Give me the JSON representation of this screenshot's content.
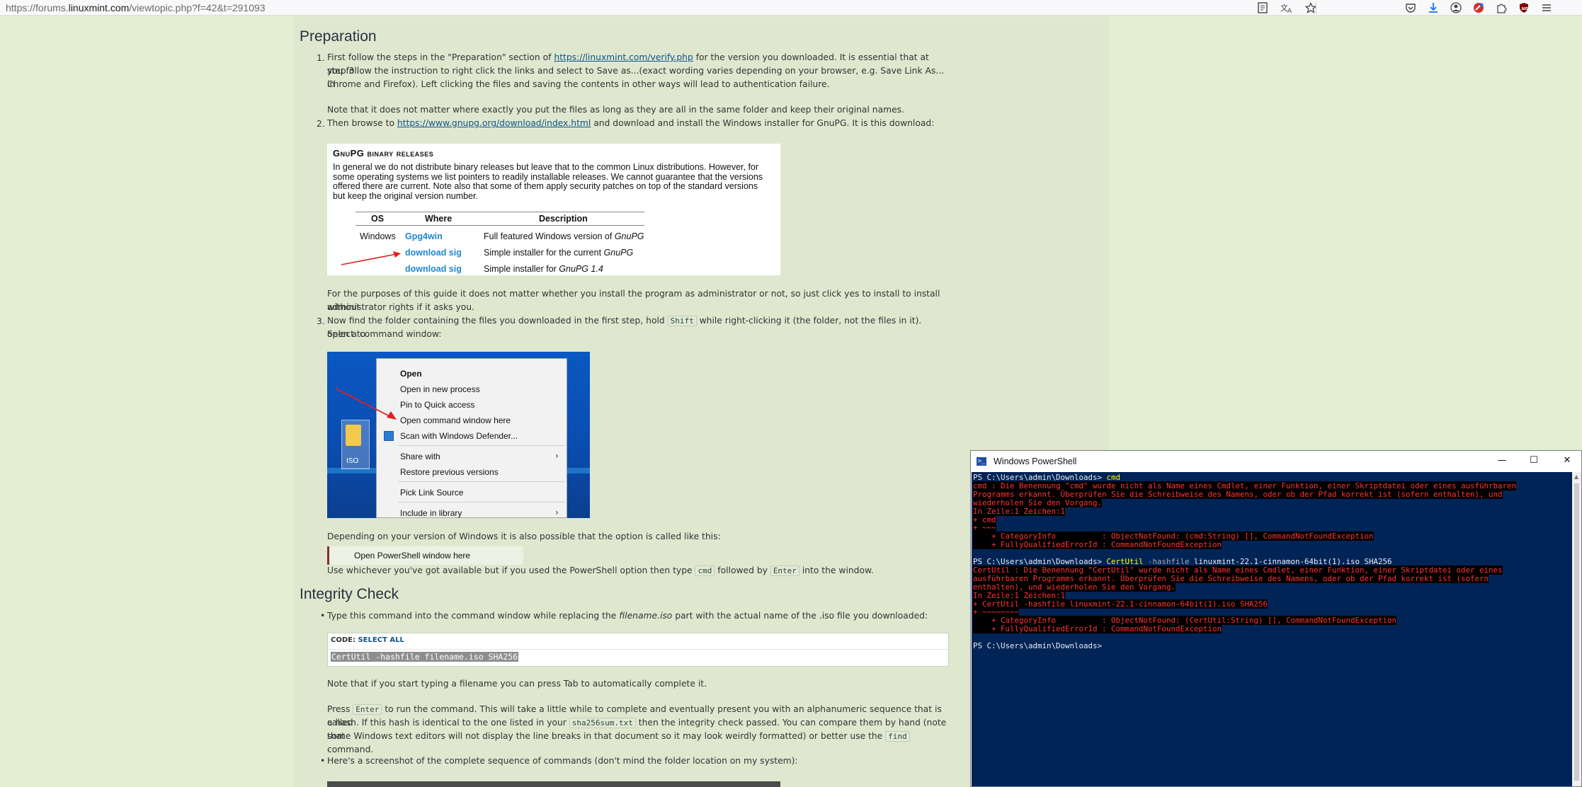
{
  "browser": {
    "url_prefix": "https://forums.",
    "url_domain": "linuxmint.com",
    "url_path": "/viewtopic.php?f=42&t=291093",
    "icons_left": [
      "reader-view-icon",
      "translate-icon",
      "bookmark-star-icon"
    ],
    "icons_right": [
      "pocket-icon",
      "downloads-icon",
      "account-icon",
      "extension-red-icon",
      "extensions-icon",
      "ublock-icon",
      "menu-icon"
    ]
  },
  "section_preparation": {
    "heading": "Preparation",
    "step1_num": "1.",
    "step1_a": "First follow the steps in the \"Preparation\" section of ",
    "step1_link": "https://linuxmint.com/verify.php",
    "step1_b": " for the version you downloaded. It is essential that at step 3",
    "step1_line2": "you follow the instruction to right click the links and select to Save as...(exact wording varies depending on your browser, e.g. Save Link As... in",
    "step1_line3": "Chrome and Firefox). Left clicking the files and saving the contents in other ways will lead to authentication failure.",
    "step1_note": "Note that it does not matter where exactly you put the files as long as they are all in the same folder and keep their original names.",
    "step2_num": "2.",
    "step2_a": "Then browse to ",
    "step2_link": "https://www.gnupg.org/download/index.html",
    "step2_b": " and download and install the Windows installer for GnuPG. It is this download:",
    "gnupg": {
      "title": "GnuPG binary releases",
      "desc": "In general we do not distribute binary releases but leave that to the common Linux distributions. However, for some operating systems we list pointers to readily installable releases. We cannot guarantee that the versions offered there are current. Note also that some of them apply security patches on top of the standard versions but keep the original version number.",
      "headers": [
        "OS",
        "Where",
        "Description"
      ],
      "rows": [
        {
          "os": "Windows",
          "where": "Gpg4win",
          "desc_a": "Full featured Windows version of ",
          "desc_b": "GnuPG"
        },
        {
          "os": "",
          "where": "download sig",
          "desc_a": "Simple installer for the current ",
          "desc_b": "GnuPG"
        },
        {
          "os": "",
          "where": "download sig",
          "desc_a": "Simple installer for ",
          "desc_b": "GnuPG 1.4"
        }
      ]
    },
    "step2_note_l1": "For the purposes of this guide it does not matter whether you install the program as administrator or not, so just click yes to install to install without",
    "step2_note_l2": "administrator rights if it asks you.",
    "step3_num": "3.",
    "step3_a": "Now find the folder containing the files you downloaded in the first step, hold ",
    "step3_kbd": "Shift",
    "step3_b": " while right-clicking it (the folder, not the files in it). Select to",
    "step3_line2": "open a command window:",
    "ctx_menu": {
      "folder_label": "ISO",
      "items": [
        "Open",
        "Open in new process",
        "Pin to Quick access",
        "Open command window here",
        "Scan with Windows Defender...",
        "Share with",
        "Restore previous versions",
        "Pick Link Source",
        "Include in library"
      ]
    },
    "alt_text": "Depending on your version of Windows it is also possible that the option is called like this:",
    "alt_option": "Open PowerShell window here",
    "use_a": "Use whichever you've got available but if you used the PowerShell option then type ",
    "use_kbd1": "cmd",
    "use_b": " followed by ",
    "use_kbd2": "Enter",
    "use_c": " into the window."
  },
  "section_integrity": {
    "heading": "Integrity Check",
    "bullet1_a": "Type this command into the command window while replacing the ",
    "bullet1_em": "filename.iso",
    "bullet1_b": " part with the actual name of the .iso file you downloaded:",
    "code_label": "CODE: ",
    "code_select": "SELECT ALL",
    "code_text": "CertUtil -hashfile filename.iso SHA256",
    "tab_note": "Note that if you start typing a filename you can press Tab to automatically complete it.",
    "press_a": "Press ",
    "press_kbd": "Enter",
    "press_b": " to run the command. This will take a little while to complete and eventually present you with an alphanumeric sequence that is called",
    "press_l2a": "a hash. If this hash is identical to the one listed in your ",
    "press_l2kbd": "sha256sum.txt",
    "press_l2b": " then the integrity check passed. You can compare them by hand (note that",
    "press_l3a": "some Windows text editors will not display the line breaks in that document so it may look weirdly formatted) or better use the ",
    "press_l3kbd": "find",
    "press_l3b": " command.",
    "dot": ".",
    "bullet2": "Here's a screenshot of the complete sequence of commands (don't mind the folder location on my system):"
  },
  "powershell": {
    "title": "Windows PowerShell",
    "controls": [
      "—",
      "☐",
      "✕"
    ],
    "lines": [
      {
        "prompt": "PS C:\\Users\\admin\\Downloads> ",
        "cmd": "cmd",
        "args": ""
      },
      {
        "err": "cmd : Die Benennung \"cmd\" wurde nicht als Name eines Cmdlet, einer Funktion, einer Skriptdatei oder eines ausführbaren"
      },
      {
        "err": "Programms erkannt. Überprüfen Sie die Schreibweise des Namens, oder ob der Pfad korrekt ist (sofern enthalten), und"
      },
      {
        "err": "wiederholen Sie den Vorgang."
      },
      {
        "err": "In Zeile:1 Zeichen:1"
      },
      {
        "err": "+ cmd"
      },
      {
        "err": "+ ~~~"
      },
      {
        "err": "    + CategoryInfo          : ObjectNotFound: (cmd:String) [], CommandNotFoundException"
      },
      {
        "err": "    + FullyQualifiedErrorId : CommandNotFoundException"
      },
      {
        "blank": ""
      },
      {
        "prompt": "PS C:\\Users\\admin\\Downloads> ",
        "cmd": "CertUtil",
        "args_g": " -hashfile",
        "args": " linuxmint-22.1-cinnamon-64bit(1).iso SHA256"
      },
      {
        "err": "CertUtil : Die Benennung \"CertUtil\" wurde nicht als Name eines Cmdlet, einer Funktion, einer Skriptdatei oder eines"
      },
      {
        "err": "ausführbaren Programms erkannt. Überprüfen Sie die Schreibweise des Namens, oder ob der Pfad korrekt ist (sofern"
      },
      {
        "err": "enthalten), und wiederholen Sie den Vorgang."
      },
      {
        "err": "In Zeile:1 Zeichen:1"
      },
      {
        "err": "+ CertUtil -hashfile linuxmint-22.1-cinnamon-64bit(1).iso SHA256"
      },
      {
        "err": "+ ~~~~~~~~"
      },
      {
        "err": "    + CategoryInfo          : ObjectNotFound: (CertUtil:String) [], CommandNotFoundException"
      },
      {
        "err": "    + FullyQualifiedErrorId : CommandNotFoundException"
      },
      {
        "blank": ""
      },
      {
        "prompt": "PS C:\\Users\\admin\\Downloads> ",
        "cmd": "",
        "args": ""
      }
    ]
  }
}
